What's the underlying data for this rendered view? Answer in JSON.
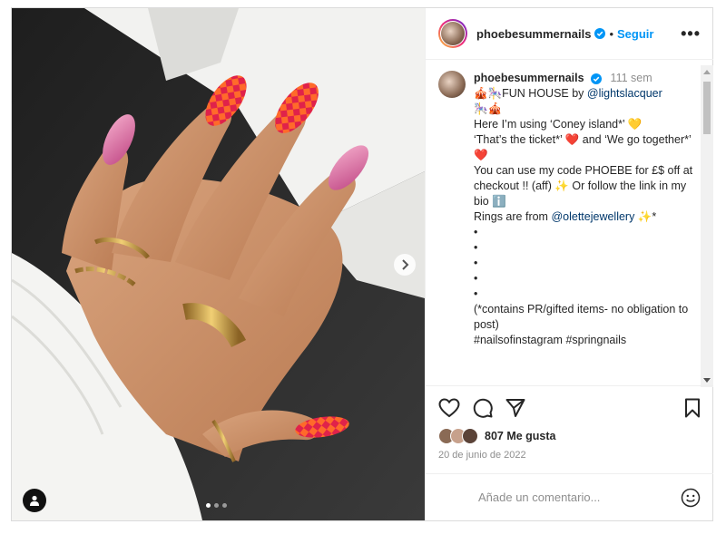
{
  "post": {
    "username": "phoebesummernails",
    "follow_label": "Seguir",
    "more_label": "•••",
    "separator": "•",
    "caption": {
      "time": "111 sem",
      "lines": [
        "🎪🎠FUN HOUSE by ",
        "🎠🎪",
        "",
        "Here I’m using ‘Coney island*’ 💛",
        "‘That’s the ticket*’ ❤️ and ‘We go together*’ ❤️",
        "",
        "You can use my code PHOEBE for £$ off at checkout !! (aff) ✨ Or follow the link in my bio ℹ️",
        "",
        "Rings are from ",
        "•",
        "•",
        "•",
        "•",
        "•",
        "(*contains PR/gifted items- no obligation to post)",
        "#nailsofinstagram #springnails"
      ],
      "mention_1": "@lightslacquer",
      "mention_2": "@olettejewellery",
      "rings_suffix": " ✨*"
    },
    "likes": "807 Me gusta",
    "date": "20 de junio de 2022",
    "comment_placeholder": "Añade un comentario...",
    "carousel": {
      "slides": 3,
      "active": 0
    }
  },
  "icons": {
    "header_more": "more-horizontal-icon",
    "like": "heart-icon",
    "comment": "comment-icon",
    "share": "send-icon",
    "save": "bookmark-icon",
    "emoji": "emoji-icon",
    "next": "chevron-right-icon",
    "tagged": "user-tag-icon",
    "verified": "verified-badge-icon"
  },
  "colors": {
    "accent": "#0095f6",
    "mention": "#00376b",
    "text": "#262626",
    "muted": "#8e8e8e",
    "verified": "#0095f6"
  }
}
